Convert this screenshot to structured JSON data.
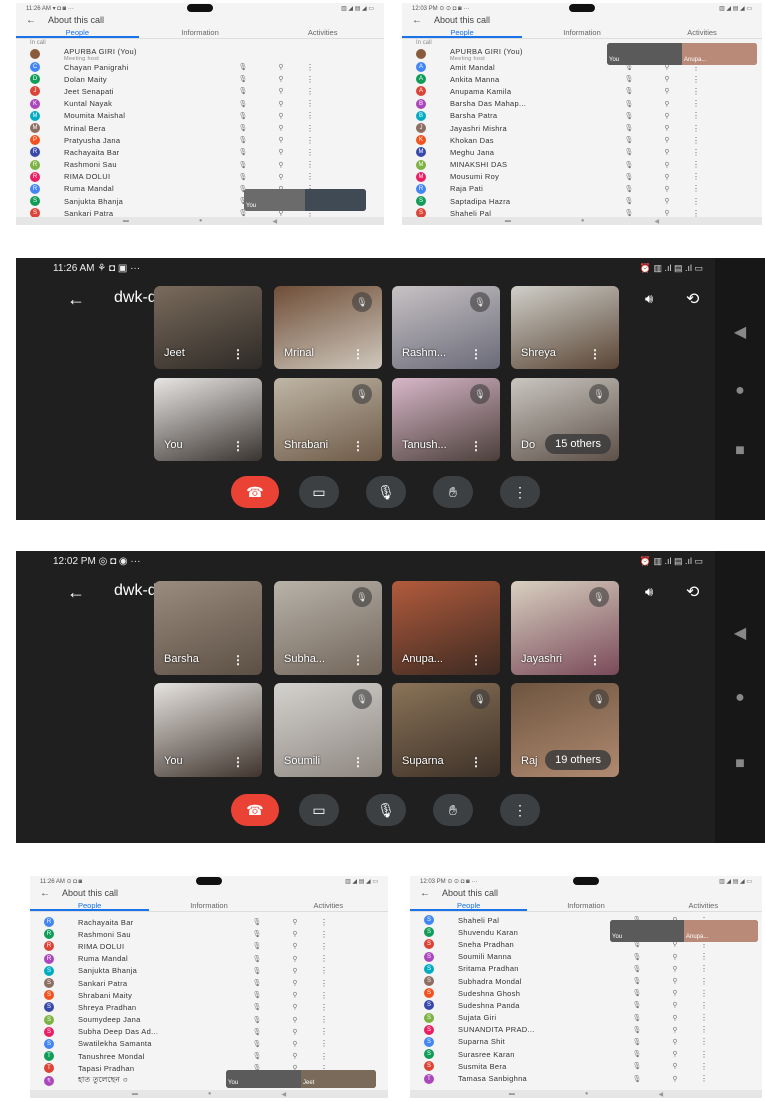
{
  "panel_a": {
    "status": "11:26 AM ▾ ◘ ◙  ···",
    "status_right": "▥ ◢ ▤ ◢ ▭",
    "title": "About this call",
    "tabs": [
      "People",
      "Information",
      "Activities"
    ],
    "section": "In call",
    "host": "APURBA GIRI (You)",
    "host_role": "Meeting host",
    "people": [
      "Chayan Panigrahi",
      "Dolan Maity",
      "Jeet Senapati",
      "Kuntal Nayak",
      "Moumita Maishal",
      "Mrinal Bera",
      "Pratyusha Jana",
      "Rachayaita Bar",
      "Rashmoni Sau",
      "RIMA DOLUI",
      "Ruma Mandal",
      "Sanjukta Bhanja",
      "Sankari Patra"
    ],
    "pip_left": "You",
    "pip_right": ""
  },
  "panel_b": {
    "status": "12:03 PM ⊙ ⊙ ◘ ◙  ···",
    "status_right": "▥ ◢ ▤ ◢ ▭",
    "title": "About this call",
    "tabs": [
      "People",
      "Information",
      "Activities"
    ],
    "section": "In call",
    "host": "APURBA GIRI (You)",
    "host_role": "Meeting host",
    "people": [
      "Amit Mandal",
      "Ankita Manna",
      "Anupama Kamila",
      "Barsha Das Mahap...",
      "Barsha Patra",
      "Jayashri Mishra",
      "Khokan Das",
      "Meghu Jana",
      "MINAKSHI DAS",
      "Mousumi Roy",
      "Raja Pati",
      "Saptadipa Hazra",
      "Shaheli Pal"
    ],
    "pip_left": "You",
    "pip_right": "Anupa..."
  },
  "call_1": {
    "time": "11:26 AM",
    "status_icons": "⚘ ◘ ▣  ···",
    "status_right": "⏰ ▥ .ıl ▤ .ıl ▭",
    "code": "dwk-deyx-yvc",
    "tiles_row1": [
      "Jeet",
      "Mrinal",
      "Rashm...",
      "Shreya"
    ],
    "tiles_row2": [
      "You",
      "Shrabani",
      "Tanush...",
      "Do"
    ],
    "others": "15 others"
  },
  "call_2": {
    "time": "12:02 PM",
    "status_icons": "◎ ◘ ◉  ···",
    "status_right": "⏰ ▥ .ıl ▤ .ıl ▭",
    "code": "dwk-deyx-yvc",
    "tiles_row1": [
      "Barsha",
      "Subha...",
      "Anupa...",
      "Jayashri"
    ],
    "tiles_row2": [
      "You",
      "Soumili",
      "Suparna",
      "Raj"
    ],
    "others": "19 others"
  },
  "panel_c": {
    "status": "11:26 AM ⊙ ◘ ◙",
    "status_right": "▥ ◢ ▤ ◢ ▭",
    "title": "About this call",
    "tabs": [
      "People",
      "Information",
      "Activities"
    ],
    "people": [
      "Rachayaita Bar",
      "Rashmoni Sau",
      "RIMA DOLUI",
      "Ruma Mandal",
      "Sanjukta Bhanja",
      "Sankari Patra",
      "Shrabani Maity",
      "Shreya Pradhan",
      "Soumydeep Jana",
      "Subha Deep Das Ad...",
      "Swatilekha Samanta",
      "Tanushree Mondal",
      "Tapasi Pradhan",
      "হাত তুলেছেন ৩"
    ],
    "pip_left": "You",
    "pip_right": "Jeet"
  },
  "panel_d": {
    "status": "12:03 PM ⊙ ⊙ ◘ ◙  ···",
    "status_right": "▥ ◢ ▤ ◢ ▭",
    "title": "About this call",
    "tabs": [
      "People",
      "Information",
      "Activities"
    ],
    "people": [
      "Shaheli Pal",
      "Shuvendu Karan",
      "Sneha Pradhan",
      "Soumili Manna",
      "Sritama Pradhan",
      "Subhadra Mondal",
      "Sudeshna Ghosh",
      "Sudeshna Panda",
      "Sujata Giri",
      "SUNANDITA PRAD...",
      "Suparna Shit",
      "Surasree Karan",
      "Susmita Bera",
      "Tamasa Sanbighna"
    ],
    "pip_left": "You",
    "pip_right": "Anupa..."
  },
  "colors": {
    "accent": "#1a73e8",
    "end_call": "#ea4335",
    "dark_bg": "#1f1f1f"
  }
}
